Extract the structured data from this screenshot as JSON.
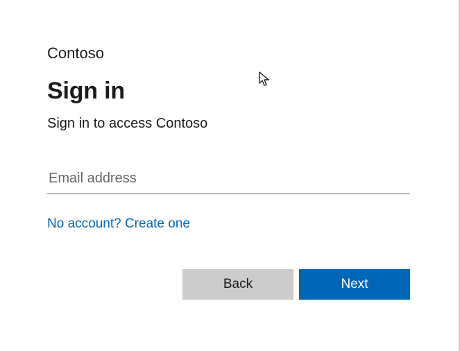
{
  "brand": "Contoso",
  "title": "Sign in",
  "subtitle": "Sign in to access Contoso",
  "email": {
    "placeholder": "Email address",
    "value": ""
  },
  "create_account_link": "No account? Create one",
  "buttons": {
    "back": "Back",
    "next": "Next"
  },
  "colors": {
    "primary": "#0067b8",
    "secondary_button": "#cccccc",
    "text": "#1b1b1b"
  }
}
